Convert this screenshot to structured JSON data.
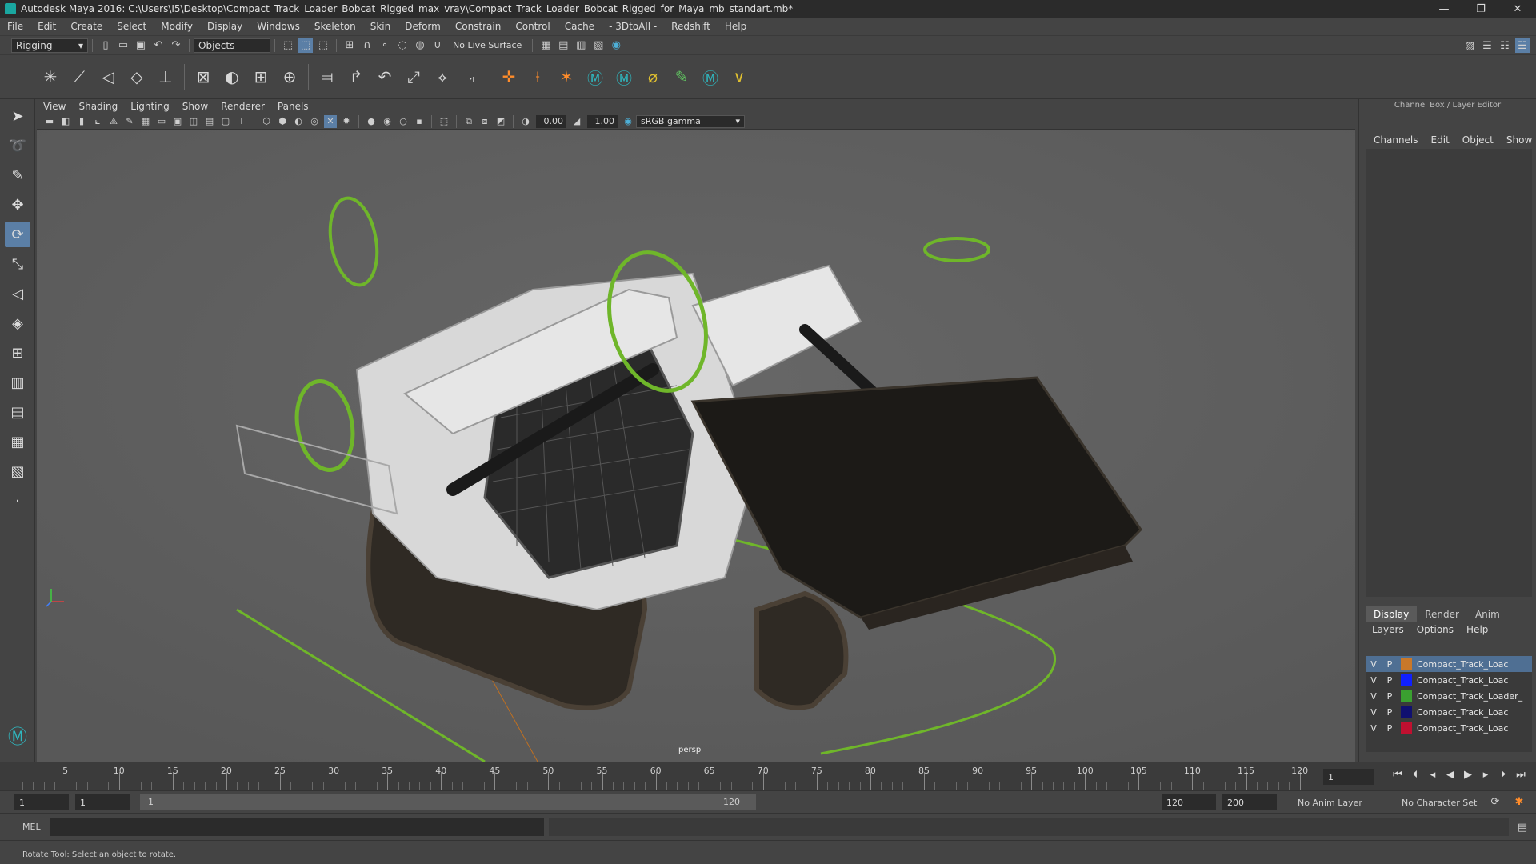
{
  "window": {
    "title": "Autodesk Maya 2016: C:\\Users\\I5\\Desktop\\Compact_Track_Loader_Bobcat_Rigged_max_vray\\Compact_Track_Loader_Bobcat_Rigged_for_Maya_mb_standart.mb*"
  },
  "menubar": [
    "File",
    "Edit",
    "Create",
    "Select",
    "Modify",
    "Display",
    "Windows",
    "Skeleton",
    "Skin",
    "Deform",
    "Constrain",
    "Control",
    "Cache",
    "- 3DtoAll -",
    "Redshift",
    "Help"
  ],
  "statusline": {
    "menuset": "Rigging",
    "select_mode": "Objects",
    "live_surface": "No Live Surface"
  },
  "panel": {
    "menu": [
      "View",
      "Shading",
      "Lighting",
      "Show",
      "Renderer",
      "Panels"
    ],
    "exposure": "0.00",
    "gamma": "1.00",
    "colorspace": "sRGB gamma",
    "camera_label": "persp"
  },
  "right_panel": {
    "title": "Channel Box / Layer Editor",
    "cb_tabs": [
      "Channels",
      "Edit",
      "Object",
      "Show"
    ],
    "le_tabs": [
      "Display",
      "Render",
      "Anim"
    ],
    "le_menu": [
      "Layers",
      "Options",
      "Help"
    ],
    "layers": [
      {
        "v": "V",
        "p": "P",
        "name": "Compact_Track_Loac",
        "color": "#c8782a",
        "selected": true
      },
      {
        "v": "V",
        "p": "P",
        "name": "Compact_Track_Loac",
        "color": "#1020ff",
        "selected": false
      },
      {
        "v": "V",
        "p": "P",
        "name": "Compact_Track_Loader_",
        "color": "#3aa030",
        "selected": false
      },
      {
        "v": "V",
        "p": "P",
        "name": "Compact_Track_Loac",
        "color": "#101070",
        "selected": false
      },
      {
        "v": "V",
        "p": "P",
        "name": "Compact_Track_Loac",
        "color": "#c01030",
        "selected": false
      }
    ]
  },
  "timeline": {
    "labels": [
      "5",
      "10",
      "15",
      "20",
      "25",
      "30",
      "35",
      "40",
      "45",
      "50",
      "55",
      "60",
      "65",
      "70",
      "75",
      "80",
      "85",
      "90",
      "95",
      "100",
      "105",
      "110",
      "115",
      "120"
    ],
    "current_frame": "1"
  },
  "range": {
    "start": "1",
    "anim_start": "1",
    "slider_start": "1",
    "slider_end": "120",
    "end": "120",
    "anim_end": "200",
    "anim_layer": "No Anim Layer",
    "char_set": "No Character Set"
  },
  "cmdline": {
    "lang": "MEL"
  },
  "helpline": {
    "text": "Rotate Tool: Select an object to rotate."
  },
  "colors": {
    "accent": "#5b7fa6",
    "rig_green": "#6fb62a"
  }
}
